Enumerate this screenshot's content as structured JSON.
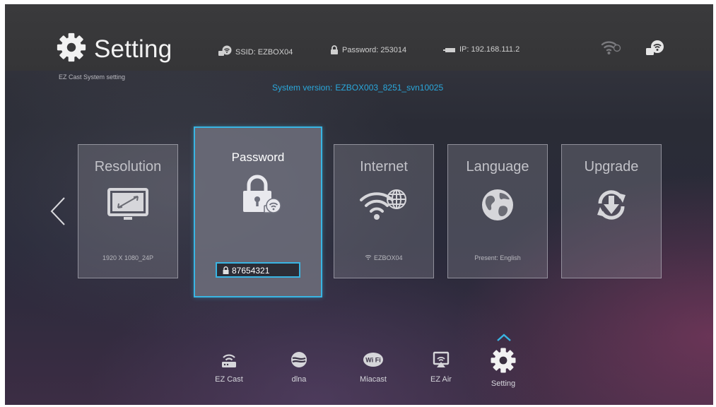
{
  "header": {
    "title": "Setting",
    "subtitle": "EZ Cast System setting",
    "ssid": "SSID: EZBOX04",
    "password": "Password: 253014",
    "ip": "IP: 192.168.111.2",
    "system_version_label": "System version:",
    "system_version_value": "EZBOX003_8251_svn10025"
  },
  "cards": [
    {
      "title": "Resolution",
      "subtitle": "1920 X 1080_24P",
      "icon": "monitor-icon"
    },
    {
      "title": "Password",
      "value": "87654321",
      "icon": "lock-icon",
      "selected": true
    },
    {
      "title": "Internet",
      "subtitle": "EZBOX04",
      "icon": "wifi-globe-icon"
    },
    {
      "title": "Language",
      "subtitle": "Present: English",
      "icon": "globe-icon"
    },
    {
      "title": "Upgrade",
      "subtitle": "",
      "icon": "upgrade-icon"
    }
  ],
  "dock": [
    {
      "label": "EZ Cast",
      "icon": "router-icon"
    },
    {
      "label": "dlna",
      "icon": "dlna-icon"
    },
    {
      "label": "Miacast",
      "icon": "wifi-badge-icon"
    },
    {
      "label": "EZ Air",
      "icon": "airplay-icon"
    },
    {
      "label": "Setting",
      "icon": "gear-icon",
      "active": true
    }
  ],
  "colors": {
    "accent": "#39b5e3",
    "version_text": "#2aa8dc"
  }
}
